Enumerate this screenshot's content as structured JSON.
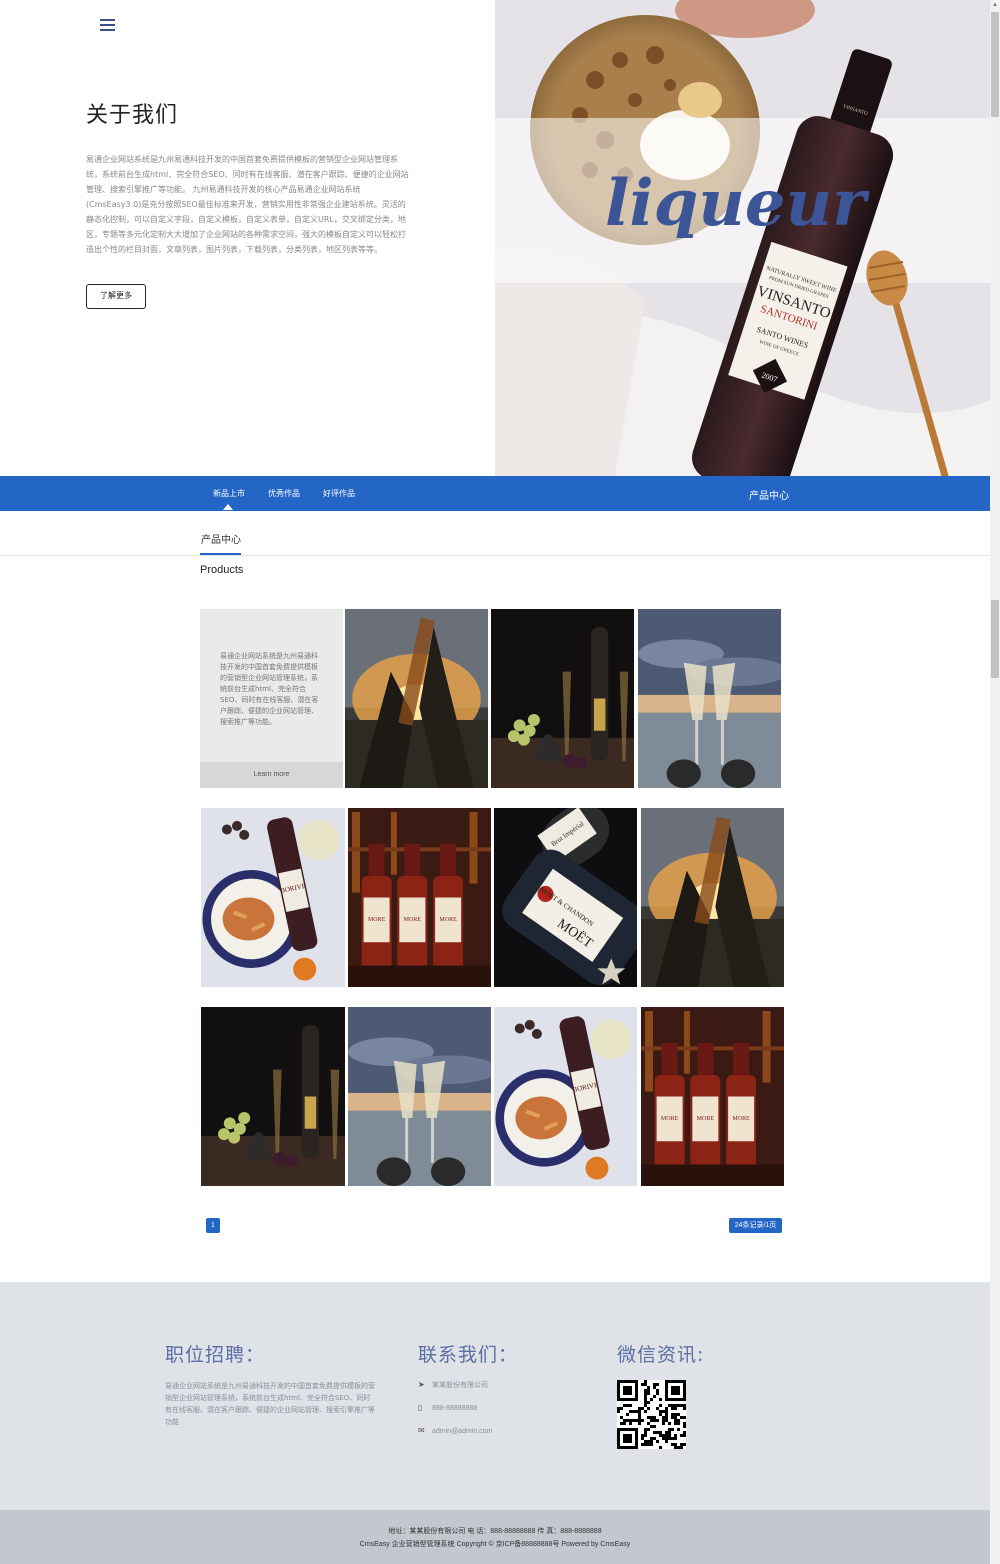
{
  "hero": {
    "menu_icon": "hamburger-menu-icon",
    "about_title": "关于我们",
    "about_text": "易通企业网站系统是九州易通科技开发的中国首套免费提供模板的营销型企业网站管理系统，系统前台生成html、完全符合SEO、同时有在线客服、潜在客户跟踪、便捷的企业网站管理、搜索引擎推广等功能。 九州易通科技开发的核心产品易通企业网站系统(CmsEasy3.0)是充分按照SEO最佳标准来开发，营销实用性非常强企业建站系统。灵活的静态化控制，可以自定义字段，自定义模板，自定义表单，自定义URL，交叉绑定分类，地区，专题等多元化定制大大增加了企业网站的各种需求空间，强大的模板自定义可以轻松打造出个性的栏目封面，文章列表，图片列表，下载列表，分类列表，地区列表等等。",
    "learn_more_button": "了解更多",
    "banner_script": "liqueur",
    "bottle_label": {
      "line1": "NATURALLY SWEET WINE",
      "line2": "FROM SUN DRIED GRAPES",
      "brand": "VINSANTO",
      "region": "SANTORINI",
      "maker": "SANTO WINES",
      "origin": "WINE OF GREECE",
      "year": "2007",
      "neck": "VINSANTO"
    }
  },
  "nav": {
    "items": [
      {
        "label": "新品上市",
        "active": true
      },
      {
        "label": "优秀作品",
        "active": false
      },
      {
        "label": "好评作品",
        "active": false
      }
    ],
    "right_title": "产品中心"
  },
  "section": {
    "tab_label": "产品中心",
    "products_label": "Products",
    "accent_color": "#2466c6"
  },
  "intro_tile": {
    "text": "易通企业网站系统是九州易通科技开发的中国首套免费提供模板的营销型企业网站管理系统，系统前台生成html、完全符合SEO、同时有在线客服、潜在客户跟踪、便捷的企业网站管理、搜索推广等功能。",
    "learn_more": "Learn more"
  },
  "products": [
    {
      "scene": "sunset-toast"
    },
    {
      "scene": "champagne-grapes"
    },
    {
      "scene": "beach-glasses"
    },
    {
      "scene": "wine-pasta"
    },
    {
      "scene": "bar-bottles"
    },
    {
      "scene": "moet-bottle"
    },
    {
      "scene": "sunset-toast"
    },
    {
      "scene": "champagne-grapes"
    },
    {
      "scene": "beach-glasses"
    },
    {
      "scene": "wine-pasta"
    },
    {
      "scene": "bar-bottles"
    }
  ],
  "product_labels": {
    "moet_brand": "MOËT",
    "moet_sub": "Brut Impérial",
    "moet_house": "MOËT & CHANDON",
    "pasta_wine": "BORIVE",
    "bar_wine": "MORE"
  },
  "pagination": {
    "current_page": "1",
    "summary": "24条记录/1页"
  },
  "footer": {
    "jobs_title": "职位招聘：",
    "jobs_text": "易通企业网站系统是九州易通科技开发的中国首套免费提供模板的营销型企业网站管理系统，系统前台生成html、完全符合SEO、同时有在线客服、潜在客户跟踪、便捷的企业网站管理、搜索引擎推广等功能",
    "contact_title": "联系我们：",
    "contact": [
      {
        "icon": "send-icon",
        "text": "某某股份有限公司"
      },
      {
        "icon": "phone-icon",
        "text": "888-88888888"
      },
      {
        "icon": "mail-icon",
        "text": "admin@admin.com"
      }
    ],
    "wechat_title": "微信资讯:",
    "qr_icon": "qr-code-icon"
  },
  "bottom": {
    "line1": "地址：某某股份有限公司   电 话：888-88888888   传 真：888-8888888",
    "line2": "CmsEasy 企业营销型管理系统 Copyright ©    京ICP备88888888号    Powered by CmsEasy"
  }
}
